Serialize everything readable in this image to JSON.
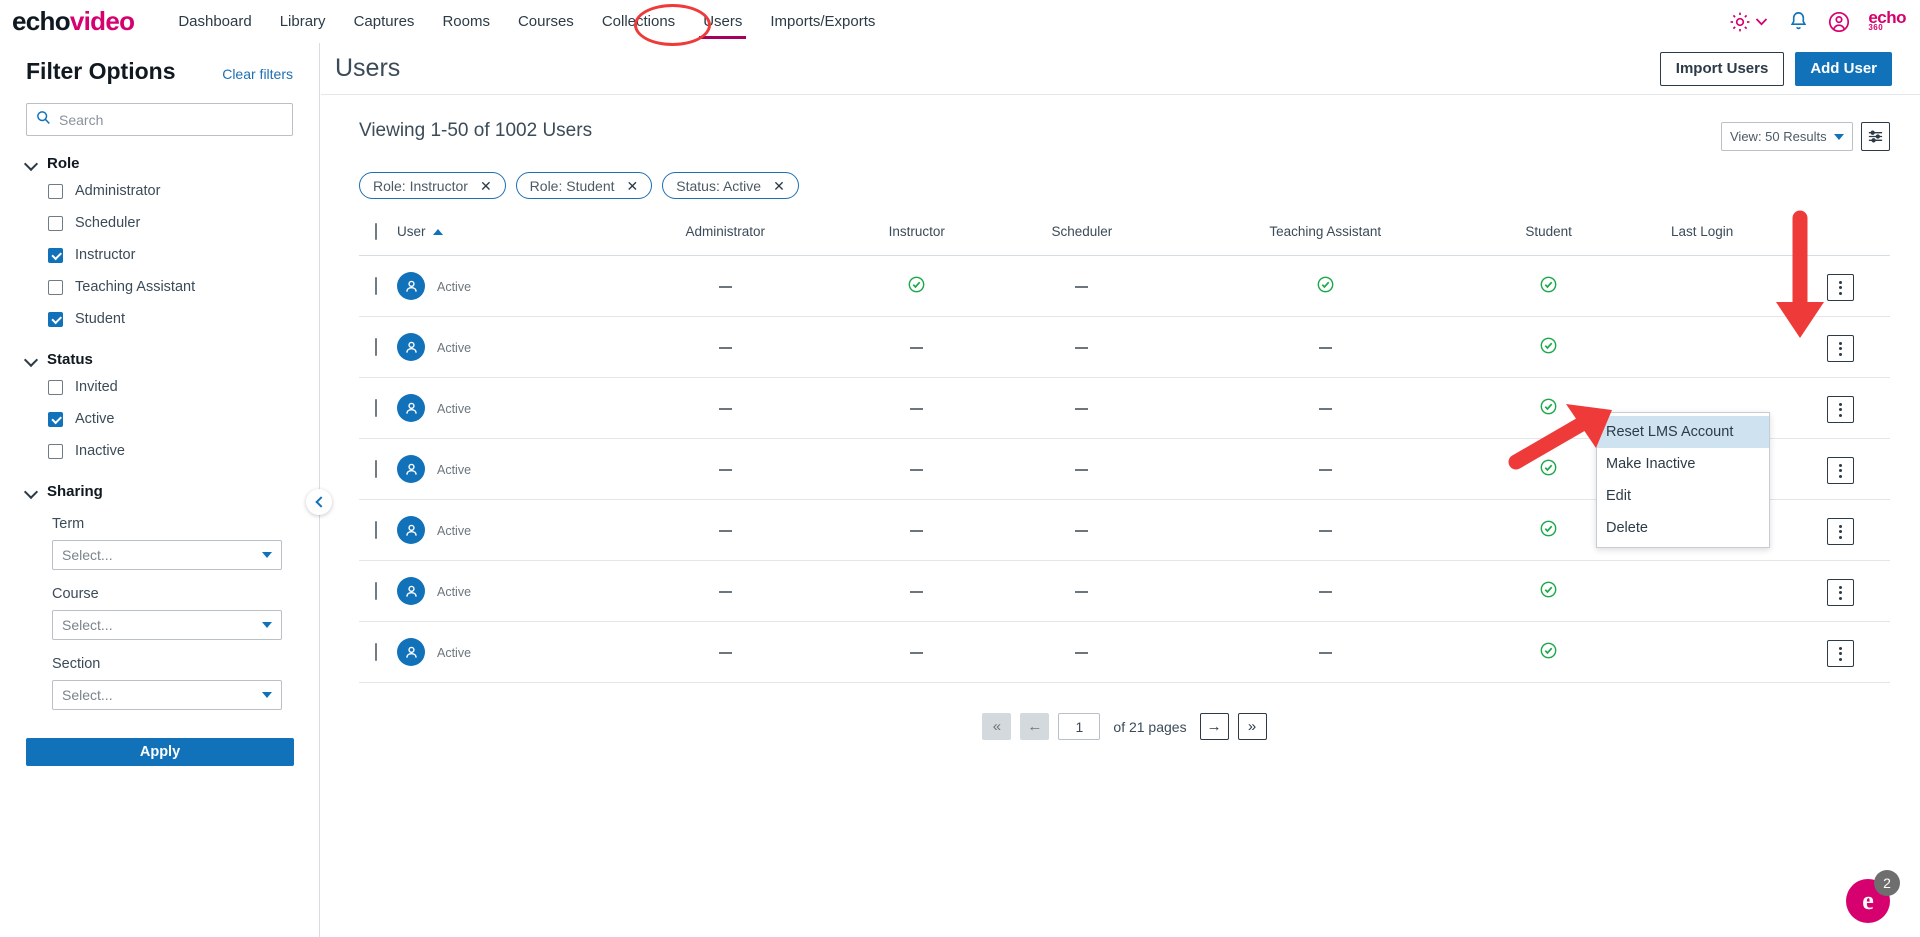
{
  "brand": {
    "logo_primary": "echo",
    "logo_accent": "video",
    "accent_color": "#d6006e",
    "secondary_logo": "echo",
    "secondary_logo_sub": "360",
    "link_blue": "#1172ba",
    "active_underline": "#a4005c",
    "success_green": "#1aa84a",
    "annotation_red": "#ef3a3a"
  },
  "topnav": {
    "items": [
      {
        "label": "Dashboard",
        "active": false
      },
      {
        "label": "Library",
        "active": false
      },
      {
        "label": "Captures",
        "active": false
      },
      {
        "label": "Rooms",
        "active": false
      },
      {
        "label": "Courses",
        "active": false
      },
      {
        "label": "Collections",
        "active": false
      },
      {
        "label": "Users",
        "active": true
      },
      {
        "label": "Imports/Exports",
        "active": false
      }
    ],
    "icons": [
      "gear-icon",
      "chevron-down-icon",
      "bell-icon",
      "user-account-icon",
      "echo360-logo"
    ]
  },
  "sidebar": {
    "title": "Filter Options",
    "clear_filters": "Clear filters",
    "search_placeholder": "Search",
    "search_value": "",
    "groups": [
      {
        "label": "Role",
        "expanded": true,
        "options": [
          {
            "label": "Administrator",
            "checked": false
          },
          {
            "label": "Scheduler",
            "checked": false
          },
          {
            "label": "Instructor",
            "checked": true
          },
          {
            "label": "Teaching Assistant",
            "checked": false
          },
          {
            "label": "Student",
            "checked": true
          }
        ]
      },
      {
        "label": "Status",
        "expanded": true,
        "options": [
          {
            "label": "Invited",
            "checked": false
          },
          {
            "label": "Active",
            "checked": true
          },
          {
            "label": "Inactive",
            "checked": false
          }
        ]
      }
    ],
    "sharing": {
      "label": "Sharing",
      "fields": [
        {
          "label": "Term",
          "value": "Select..."
        },
        {
          "label": "Course",
          "value": "Select..."
        },
        {
          "label": "Section",
          "value": "Select..."
        }
      ]
    },
    "apply_label": "Apply"
  },
  "main": {
    "page_title": "Users",
    "import_users_label": "Import Users",
    "add_user_label": "Add User",
    "viewing_text": "Viewing 1-50 of 1002 Users",
    "view_select_label": "View: 50 Results",
    "filter_chips": [
      {
        "label": "Role: Instructor"
      },
      {
        "label": "Role: Student"
      },
      {
        "label": "Status: Active"
      }
    ],
    "chip_close": "✕",
    "table": {
      "columns": [
        "User",
        "Administrator",
        "Instructor",
        "Scheduler",
        "Teaching Assistant",
        "Student",
        "Last Login"
      ],
      "sort_column": "User",
      "sort_direction": "asc",
      "rows": [
        {
          "name_redacted": true,
          "status": "Active",
          "administrator": "dash",
          "instructor": "check",
          "scheduler": "dash",
          "teaching_assistant": "check",
          "student": "check",
          "last_login": ""
        },
        {
          "name_redacted": true,
          "status": "Active",
          "administrator": "dash",
          "instructor": "dash",
          "scheduler": "dash",
          "teaching_assistant": "dash",
          "student": "check",
          "last_login": ""
        },
        {
          "name_redacted": true,
          "status": "Active",
          "administrator": "dash",
          "instructor": "dash",
          "scheduler": "dash",
          "teaching_assistant": "dash",
          "student": "check",
          "last_login": ""
        },
        {
          "name_redacted": true,
          "status": "Active",
          "administrator": "dash",
          "instructor": "dash",
          "scheduler": "dash",
          "teaching_assistant": "dash",
          "student": "check",
          "last_login": ""
        },
        {
          "name_redacted": true,
          "status": "Active",
          "administrator": "dash",
          "instructor": "dash",
          "scheduler": "dash",
          "teaching_assistant": "dash",
          "student": "check",
          "last_login": ""
        },
        {
          "name_redacted": true,
          "status": "Active",
          "administrator": "dash",
          "instructor": "dash",
          "scheduler": "dash",
          "teaching_assistant": "dash",
          "student": "check",
          "last_login": ""
        },
        {
          "name_redacted": true,
          "status": "Active",
          "administrator": "dash",
          "instructor": "dash",
          "scheduler": "dash",
          "teaching_assistant": "dash",
          "student": "check",
          "last_login": ""
        }
      ]
    },
    "context_menu": {
      "items": [
        {
          "label": "Reset LMS Account",
          "highlighted": true
        },
        {
          "label": "Make Inactive",
          "highlighted": false
        },
        {
          "label": "Edit",
          "highlighted": false
        },
        {
          "label": "Delete",
          "highlighted": false
        }
      ]
    },
    "pagination": {
      "first_label": "«",
      "prev_label": "←",
      "page_value": "1",
      "of_pages_text": "of 21 pages",
      "next_label": "→",
      "last_label": "»"
    }
  },
  "help_widget": {
    "glyph": "e",
    "badge_count": "2"
  }
}
